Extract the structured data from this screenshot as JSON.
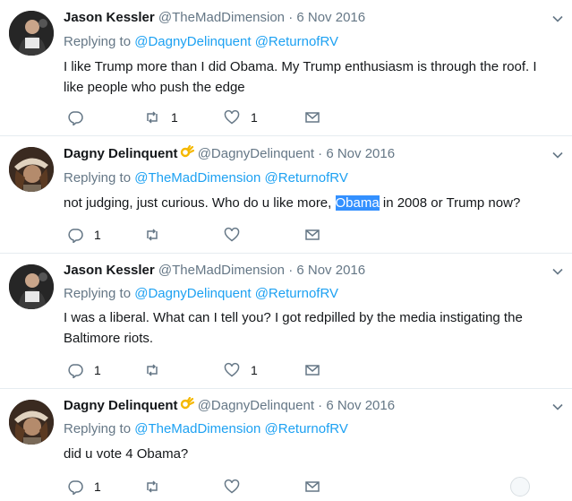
{
  "tweets": [
    {
      "name": "Jason Kessler",
      "handle": "@TheMadDimension",
      "date": "6 Nov 2016",
      "avatar": "jason-avatar",
      "replying_label": "Replying to",
      "mentions": [
        "@DagnyDelinquent",
        "@ReturnofRV"
      ],
      "text_before": "I like Trump more than I did Obama. My Trump enthusiasm is through the roof. I like people who push the edge",
      "text_highlight": "",
      "text_after": "",
      "counts": {
        "reply": "",
        "retweet": "1",
        "like": "1"
      }
    },
    {
      "name": "Dagny Delinquent",
      "handle": "@DagnyDelinquent",
      "date": "6 Nov 2016",
      "avatar": "dagny-avatar",
      "name_emoji": "ok-hand-emoji",
      "replying_label": "Replying to",
      "mentions": [
        "@TheMadDimension",
        "@ReturnofRV"
      ],
      "text_before": "not judging, just curious. Who do u like more, ",
      "text_highlight": "Obama",
      "text_after": " in 2008 or Trump now?",
      "counts": {
        "reply": "1",
        "retweet": "",
        "like": ""
      }
    },
    {
      "name": "Jason Kessler",
      "handle": "@TheMadDimension",
      "date": "6 Nov 2016",
      "avatar": "jason-avatar",
      "replying_label": "Replying to",
      "mentions": [
        "@DagnyDelinquent",
        "@ReturnofRV"
      ],
      "text_before": "I was a liberal. What can I tell you? I got redpilled by the media instigating the Baltimore riots.",
      "text_highlight": "",
      "text_after": "",
      "counts": {
        "reply": "1",
        "retweet": "",
        "like": "1"
      }
    },
    {
      "name": "Dagny Delinquent",
      "handle": "@DagnyDelinquent",
      "date": "6 Nov 2016",
      "avatar": "dagny-avatar",
      "name_emoji": "ok-hand-emoji",
      "replying_label": "Replying to",
      "mentions": [
        "@TheMadDimension",
        "@ReturnofRV"
      ],
      "text_before": "did u vote 4 Obama?",
      "text_highlight": "",
      "text_after": "",
      "counts": {
        "reply": "1",
        "retweet": "",
        "like": ""
      }
    }
  ],
  "icons": {
    "reply": "reply-icon",
    "retweet": "retweet-icon",
    "like": "heart-icon",
    "dm": "envelope-icon",
    "menu": "chevron-down-icon"
  },
  "colors": {
    "link": "#1da1f2",
    "muted": "#657786",
    "text": "#14171a",
    "selection": "#3390ff",
    "divider": "#e6ecf0"
  }
}
